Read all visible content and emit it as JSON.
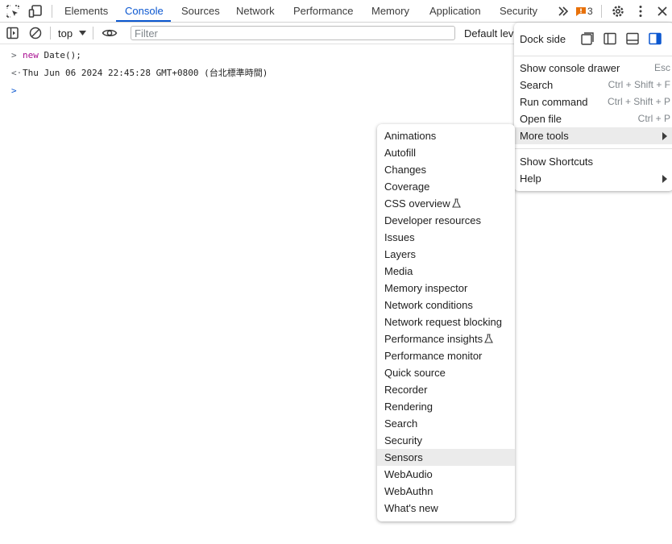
{
  "tabs": [
    {
      "label": "Elements"
    },
    {
      "label": "Console",
      "active": true
    },
    {
      "label": "Sources"
    },
    {
      "label": "Network"
    },
    {
      "label": "Performance"
    },
    {
      "label": "Memory"
    },
    {
      "label": "Application"
    },
    {
      "label": "Security"
    }
  ],
  "toolbar_icons": {
    "inspect": "inspect-element-icon",
    "device": "device-toolbar-icon",
    "more_tabs": "chevron-double-right-icon",
    "settings": "gear-icon",
    "kebab": "vertical-ellipsis-icon",
    "close": "close-icon"
  },
  "issues": {
    "count": "3",
    "color": "#e8710a"
  },
  "console_toolbar": {
    "context": "top",
    "filter_placeholder": "Filter",
    "levels_label": "Default levels"
  },
  "console_lines": [
    {
      "prefix": ">",
      "keyword": "new",
      "text": " Date();"
    },
    {
      "prefix": "<·",
      "text": "Thu Jun 06 2024 22:45:28 GMT+0800 (台北標準時間)"
    },
    {
      "prefix": ">",
      "text": ""
    }
  ],
  "main_menu": {
    "dock_side_label": "Dock side",
    "items": [
      {
        "label": "Show console drawer",
        "shortcut": "Esc"
      },
      {
        "label": "Search",
        "shortcut": "Ctrl + Shift + F"
      },
      {
        "label": "Run command",
        "shortcut": "Ctrl + Shift + P"
      },
      {
        "label": "Open file",
        "shortcut": "Ctrl + P"
      },
      {
        "label": "More tools",
        "shortcut": ""
      }
    ],
    "items2": [
      {
        "label": "Show Shortcuts"
      },
      {
        "label": "Help"
      }
    ]
  },
  "more_tools": [
    "Animations",
    "Autofill",
    "Changes",
    "Coverage",
    "CSS overview",
    "Developer resources",
    "Issues",
    "Layers",
    "Media",
    "Memory inspector",
    "Network conditions",
    "Network request blocking",
    "Performance insights",
    "Performance monitor",
    "Quick source",
    "Recorder",
    "Rendering",
    "Search",
    "Security",
    "Sensors",
    "WebAudio",
    "WebAuthn",
    "What's new"
  ],
  "accent_color": "#0b57d0"
}
